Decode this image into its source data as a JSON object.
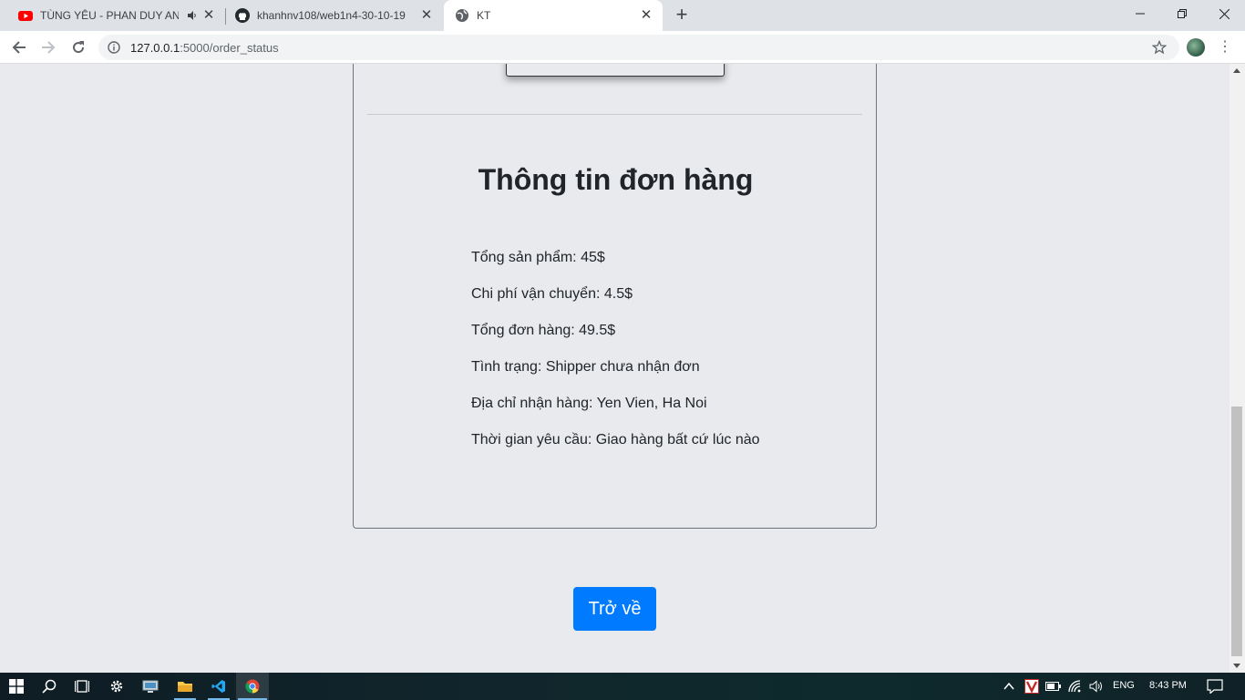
{
  "browser": {
    "tabs": [
      {
        "title": "TÙNG YÊU - PHAN DUY ANH",
        "icon": "youtube-icon",
        "audio": true
      },
      {
        "title": "khanhnv108/web1n4-30-10-19",
        "icon": "github-icon"
      },
      {
        "title": "KT",
        "icon": "globe-icon",
        "active": true
      }
    ],
    "url_host": "127.0.0.1",
    "url_rest": ":5000/order_status"
  },
  "page": {
    "heading": "Thông tin đơn hàng",
    "info": {
      "subtotal": "Tổng sản phẩm: 45$",
      "shipping": "Chi phí vận chuyển: 4.5$",
      "total": "Tổng đơn hàng: 49.5$",
      "status": "Tình trạng: Shipper chưa nhận đơn",
      "address": "Địa chỉ nhận hàng: Yen Vien, Ha Noi",
      "time": "Thời gian yêu cầu: Giao hàng bất cứ lúc nào"
    },
    "back_label": "Trở về"
  },
  "taskbar": {
    "language": "ENG",
    "clock": "8:43 PM"
  },
  "colors": {
    "page_bg": "#e8eaed",
    "button_primary": "#007bff",
    "text": "#212529"
  }
}
